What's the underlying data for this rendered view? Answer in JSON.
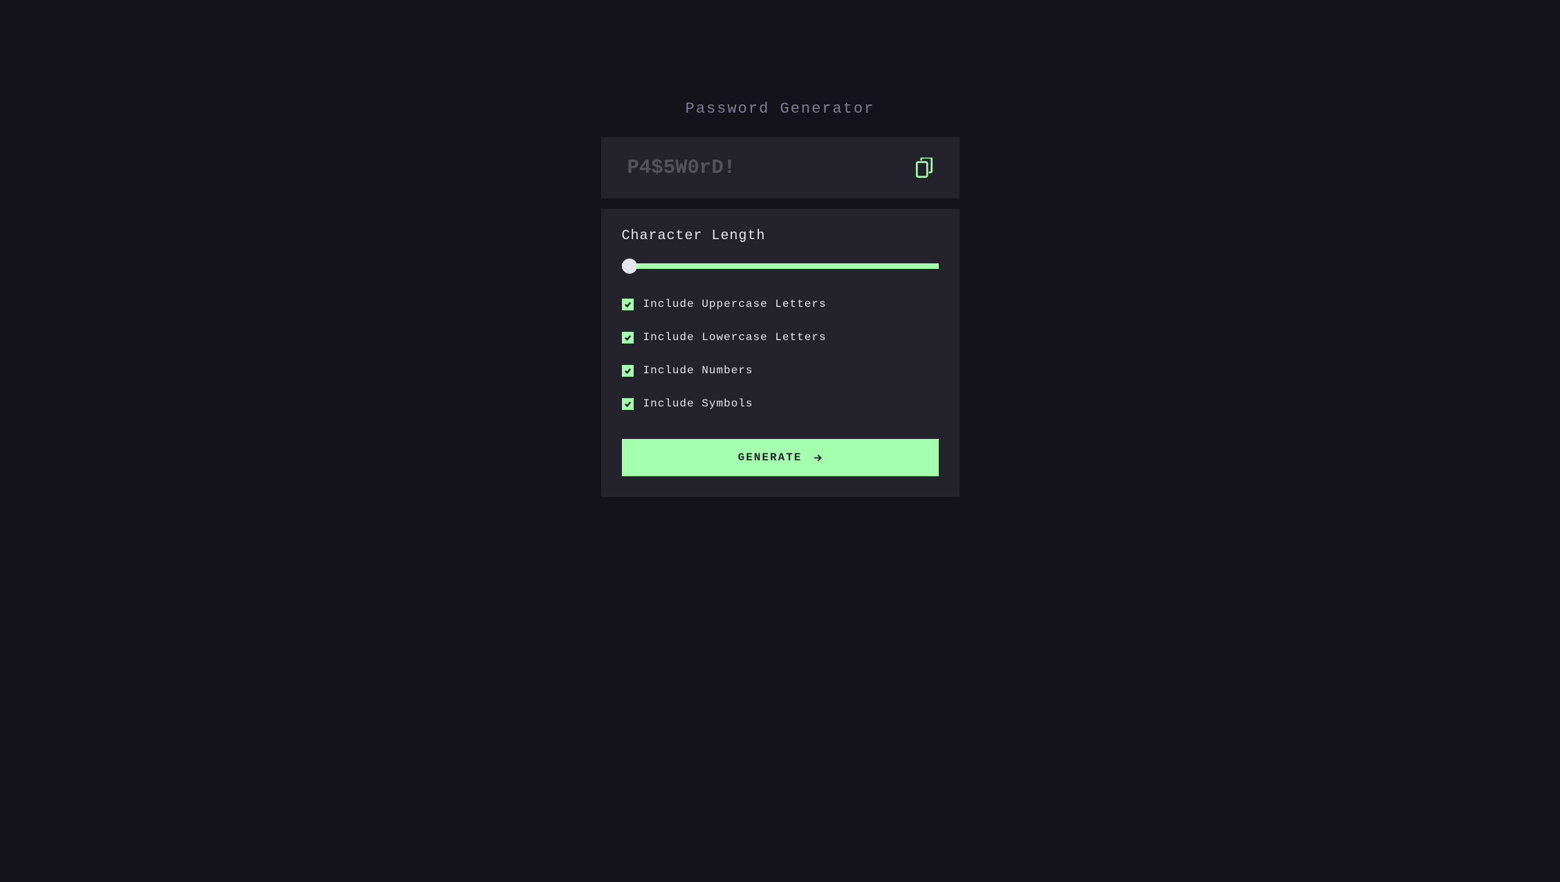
{
  "title": "Password Generator",
  "password": {
    "placeholder": "P4$5W0rD!"
  },
  "settings": {
    "length_label": "Character Length",
    "checkboxes": [
      {
        "label": "Include Uppercase Letters",
        "checked": true
      },
      {
        "label": "Include Lowercase Letters",
        "checked": true
      },
      {
        "label": "Include Numbers",
        "checked": true
      },
      {
        "label": "Include Symbols",
        "checked": true
      }
    ],
    "generate_label": "GENERATE"
  },
  "colors": {
    "background": "#14131b",
    "panel": "#24232c",
    "accent": "#a4ffaf",
    "text": "#e6e5ea",
    "muted": "#817d92",
    "placeholder": "#54535b"
  }
}
